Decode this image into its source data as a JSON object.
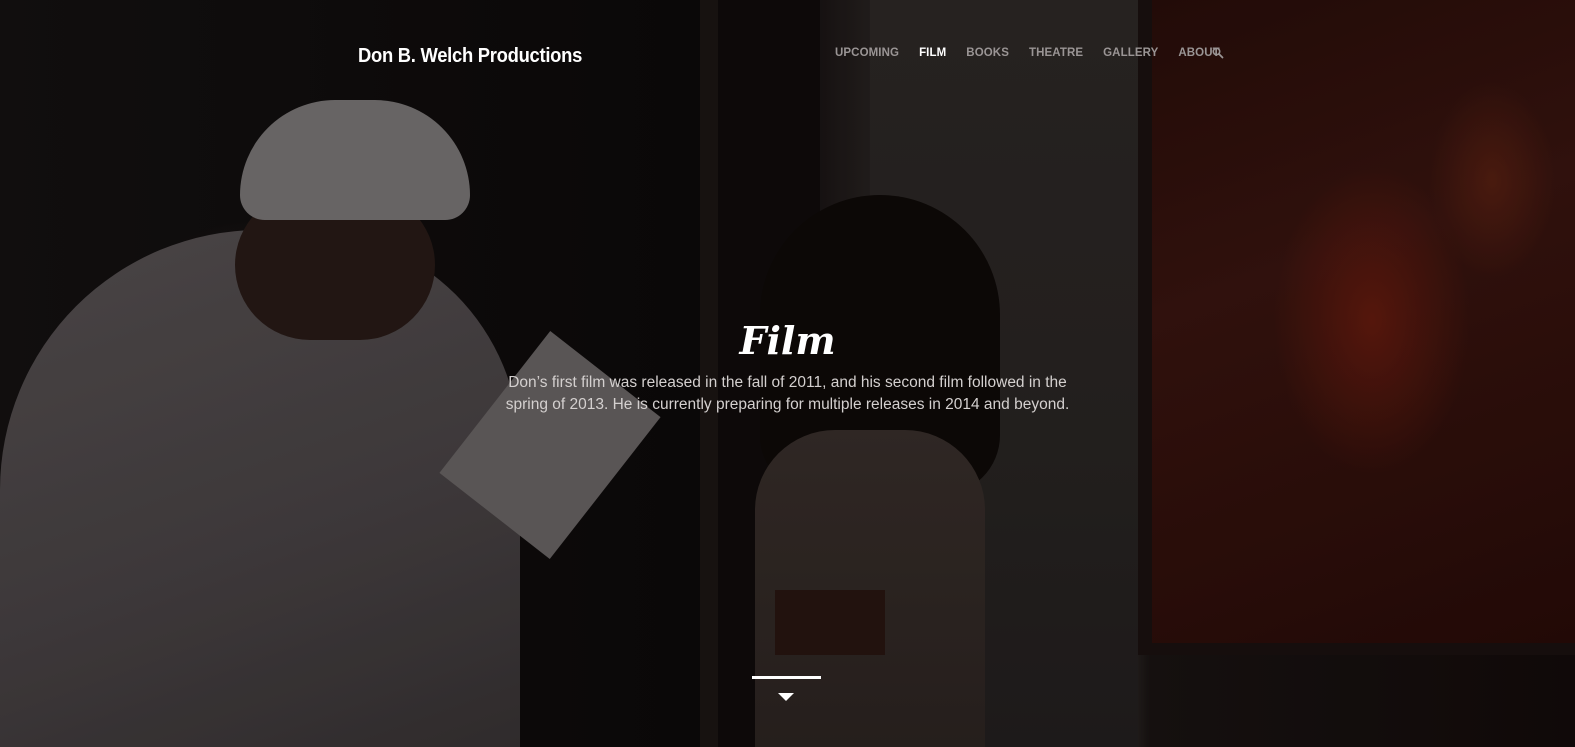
{
  "site": {
    "title": "Don B. Welch Productions"
  },
  "nav": {
    "items": [
      {
        "label": "UPCOMING",
        "active": false
      },
      {
        "label": "FILM",
        "active": true
      },
      {
        "label": "BOOKS",
        "active": false
      },
      {
        "label": "THEATRE",
        "active": false
      },
      {
        "label": "GALLERY",
        "active": false
      },
      {
        "label": "ABOUT",
        "active": false
      }
    ],
    "search_icon": "search-icon"
  },
  "hero": {
    "title": "Film",
    "description": "Don’s first film was released in the fall of 2011, and his second film followed in the spring of 2013. He is currently preparing for multiple releases in 2014 and beyond.",
    "scroll_icon": "chevron-down-icon"
  },
  "colors": {
    "nav_inactive": "#9a9595",
    "nav_active": "#ffffff",
    "text_muted": "#d4d0cf"
  }
}
